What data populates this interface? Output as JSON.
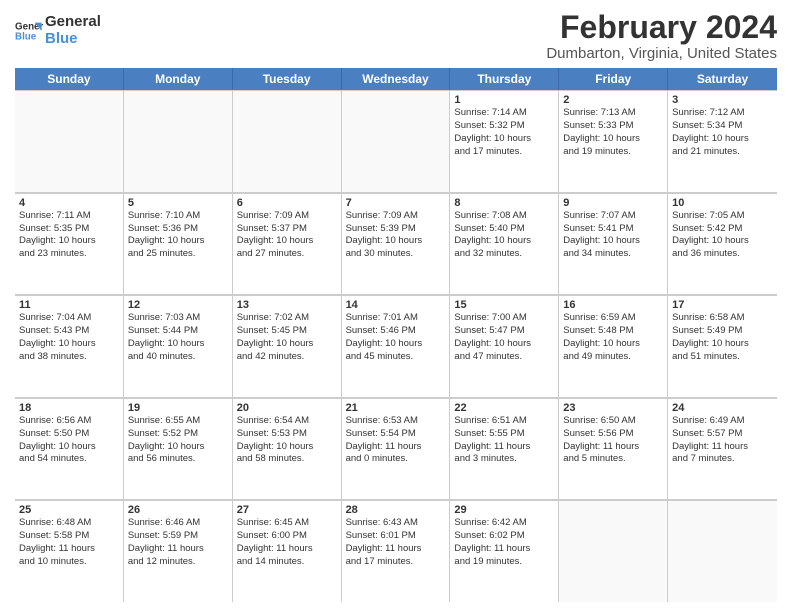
{
  "logo": {
    "line1": "General",
    "line2": "Blue"
  },
  "title": "February 2024",
  "subtitle": "Dumbarton, Virginia, United States",
  "days": [
    "Sunday",
    "Monday",
    "Tuesday",
    "Wednesday",
    "Thursday",
    "Friday",
    "Saturday"
  ],
  "rows": [
    [
      {
        "day": "",
        "info": ""
      },
      {
        "day": "",
        "info": ""
      },
      {
        "day": "",
        "info": ""
      },
      {
        "day": "",
        "info": ""
      },
      {
        "day": "1",
        "info": "Sunrise: 7:14 AM\nSunset: 5:32 PM\nDaylight: 10 hours\nand 17 minutes."
      },
      {
        "day": "2",
        "info": "Sunrise: 7:13 AM\nSunset: 5:33 PM\nDaylight: 10 hours\nand 19 minutes."
      },
      {
        "day": "3",
        "info": "Sunrise: 7:12 AM\nSunset: 5:34 PM\nDaylight: 10 hours\nand 21 minutes."
      }
    ],
    [
      {
        "day": "4",
        "info": "Sunrise: 7:11 AM\nSunset: 5:35 PM\nDaylight: 10 hours\nand 23 minutes."
      },
      {
        "day": "5",
        "info": "Sunrise: 7:10 AM\nSunset: 5:36 PM\nDaylight: 10 hours\nand 25 minutes."
      },
      {
        "day": "6",
        "info": "Sunrise: 7:09 AM\nSunset: 5:37 PM\nDaylight: 10 hours\nand 27 minutes."
      },
      {
        "day": "7",
        "info": "Sunrise: 7:09 AM\nSunset: 5:39 PM\nDaylight: 10 hours\nand 30 minutes."
      },
      {
        "day": "8",
        "info": "Sunrise: 7:08 AM\nSunset: 5:40 PM\nDaylight: 10 hours\nand 32 minutes."
      },
      {
        "day": "9",
        "info": "Sunrise: 7:07 AM\nSunset: 5:41 PM\nDaylight: 10 hours\nand 34 minutes."
      },
      {
        "day": "10",
        "info": "Sunrise: 7:05 AM\nSunset: 5:42 PM\nDaylight: 10 hours\nand 36 minutes."
      }
    ],
    [
      {
        "day": "11",
        "info": "Sunrise: 7:04 AM\nSunset: 5:43 PM\nDaylight: 10 hours\nand 38 minutes."
      },
      {
        "day": "12",
        "info": "Sunrise: 7:03 AM\nSunset: 5:44 PM\nDaylight: 10 hours\nand 40 minutes."
      },
      {
        "day": "13",
        "info": "Sunrise: 7:02 AM\nSunset: 5:45 PM\nDaylight: 10 hours\nand 42 minutes."
      },
      {
        "day": "14",
        "info": "Sunrise: 7:01 AM\nSunset: 5:46 PM\nDaylight: 10 hours\nand 45 minutes."
      },
      {
        "day": "15",
        "info": "Sunrise: 7:00 AM\nSunset: 5:47 PM\nDaylight: 10 hours\nand 47 minutes."
      },
      {
        "day": "16",
        "info": "Sunrise: 6:59 AM\nSunset: 5:48 PM\nDaylight: 10 hours\nand 49 minutes."
      },
      {
        "day": "17",
        "info": "Sunrise: 6:58 AM\nSunset: 5:49 PM\nDaylight: 10 hours\nand 51 minutes."
      }
    ],
    [
      {
        "day": "18",
        "info": "Sunrise: 6:56 AM\nSunset: 5:50 PM\nDaylight: 10 hours\nand 54 minutes."
      },
      {
        "day": "19",
        "info": "Sunrise: 6:55 AM\nSunset: 5:52 PM\nDaylight: 10 hours\nand 56 minutes."
      },
      {
        "day": "20",
        "info": "Sunrise: 6:54 AM\nSunset: 5:53 PM\nDaylight: 10 hours\nand 58 minutes."
      },
      {
        "day": "21",
        "info": "Sunrise: 6:53 AM\nSunset: 5:54 PM\nDaylight: 11 hours\nand 0 minutes."
      },
      {
        "day": "22",
        "info": "Sunrise: 6:51 AM\nSunset: 5:55 PM\nDaylight: 11 hours\nand 3 minutes."
      },
      {
        "day": "23",
        "info": "Sunrise: 6:50 AM\nSunset: 5:56 PM\nDaylight: 11 hours\nand 5 minutes."
      },
      {
        "day": "24",
        "info": "Sunrise: 6:49 AM\nSunset: 5:57 PM\nDaylight: 11 hours\nand 7 minutes."
      }
    ],
    [
      {
        "day": "25",
        "info": "Sunrise: 6:48 AM\nSunset: 5:58 PM\nDaylight: 11 hours\nand 10 minutes."
      },
      {
        "day": "26",
        "info": "Sunrise: 6:46 AM\nSunset: 5:59 PM\nDaylight: 11 hours\nand 12 minutes."
      },
      {
        "day": "27",
        "info": "Sunrise: 6:45 AM\nSunset: 6:00 PM\nDaylight: 11 hours\nand 14 minutes."
      },
      {
        "day": "28",
        "info": "Sunrise: 6:43 AM\nSunset: 6:01 PM\nDaylight: 11 hours\nand 17 minutes."
      },
      {
        "day": "29",
        "info": "Sunrise: 6:42 AM\nSunset: 6:02 PM\nDaylight: 11 hours\nand 19 minutes."
      },
      {
        "day": "",
        "info": ""
      },
      {
        "day": "",
        "info": ""
      }
    ]
  ]
}
